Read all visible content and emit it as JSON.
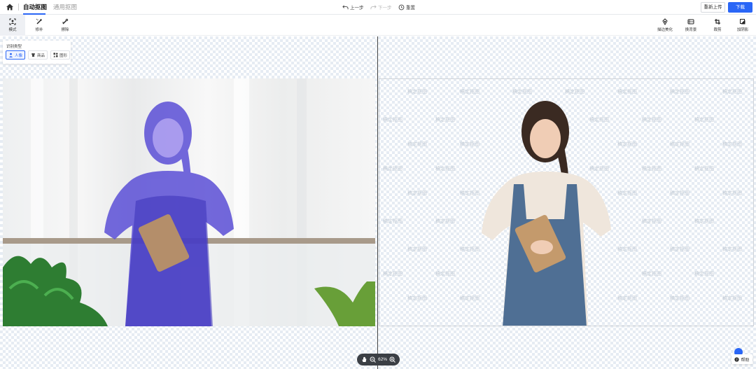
{
  "header": {
    "tabs": [
      {
        "label": "自动抠图",
        "active": true
      },
      {
        "label": "通用抠图",
        "active": false
      }
    ],
    "undo_label": "上一步",
    "redo_label": "下一步",
    "reset_label": "重置",
    "reupload_label": "重新上传",
    "download_label": "下载",
    "accent_color": "#2a66f6"
  },
  "toolbar": {
    "left_tools": [
      {
        "label": "模式",
        "icon": "scan-portrait-icon",
        "active": true
      },
      {
        "label": "修补",
        "icon": "repair-brush-icon",
        "active": false
      },
      {
        "label": "擦除",
        "icon": "erase-brush-icon",
        "active": false
      }
    ],
    "right_tools": [
      {
        "label": "描边美化",
        "icon": "stroke-icon"
      },
      {
        "label": "换背景",
        "icon": "background-icon"
      },
      {
        "label": "裁剪",
        "icon": "crop-icon"
      },
      {
        "label": "加阴影",
        "icon": "shadow-icon"
      }
    ]
  },
  "recognition_panel": {
    "title": "识别类型",
    "options": [
      {
        "label": "人像",
        "icon": "person-icon",
        "active": true
      },
      {
        "label": "商品",
        "icon": "shirt-icon",
        "active": false
      },
      {
        "label": "图形",
        "icon": "shapes-icon",
        "active": false
      }
    ]
  },
  "zoom": {
    "value": "62%"
  },
  "help_label": "帮助",
  "watermark_text": "稿定抠图"
}
